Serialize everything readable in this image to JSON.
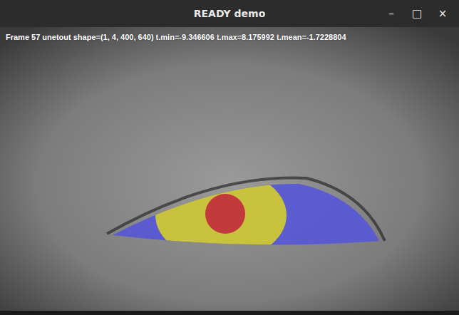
{
  "window": {
    "title": "READY demo",
    "controls": [
      "–",
      "□",
      "×"
    ]
  },
  "overlay": {
    "text": "Frame 57 unetout shape=(1, 4, 400, 640) t.min=-9.346606 t.max=8.175992 t.mean=-1.7228804"
  }
}
